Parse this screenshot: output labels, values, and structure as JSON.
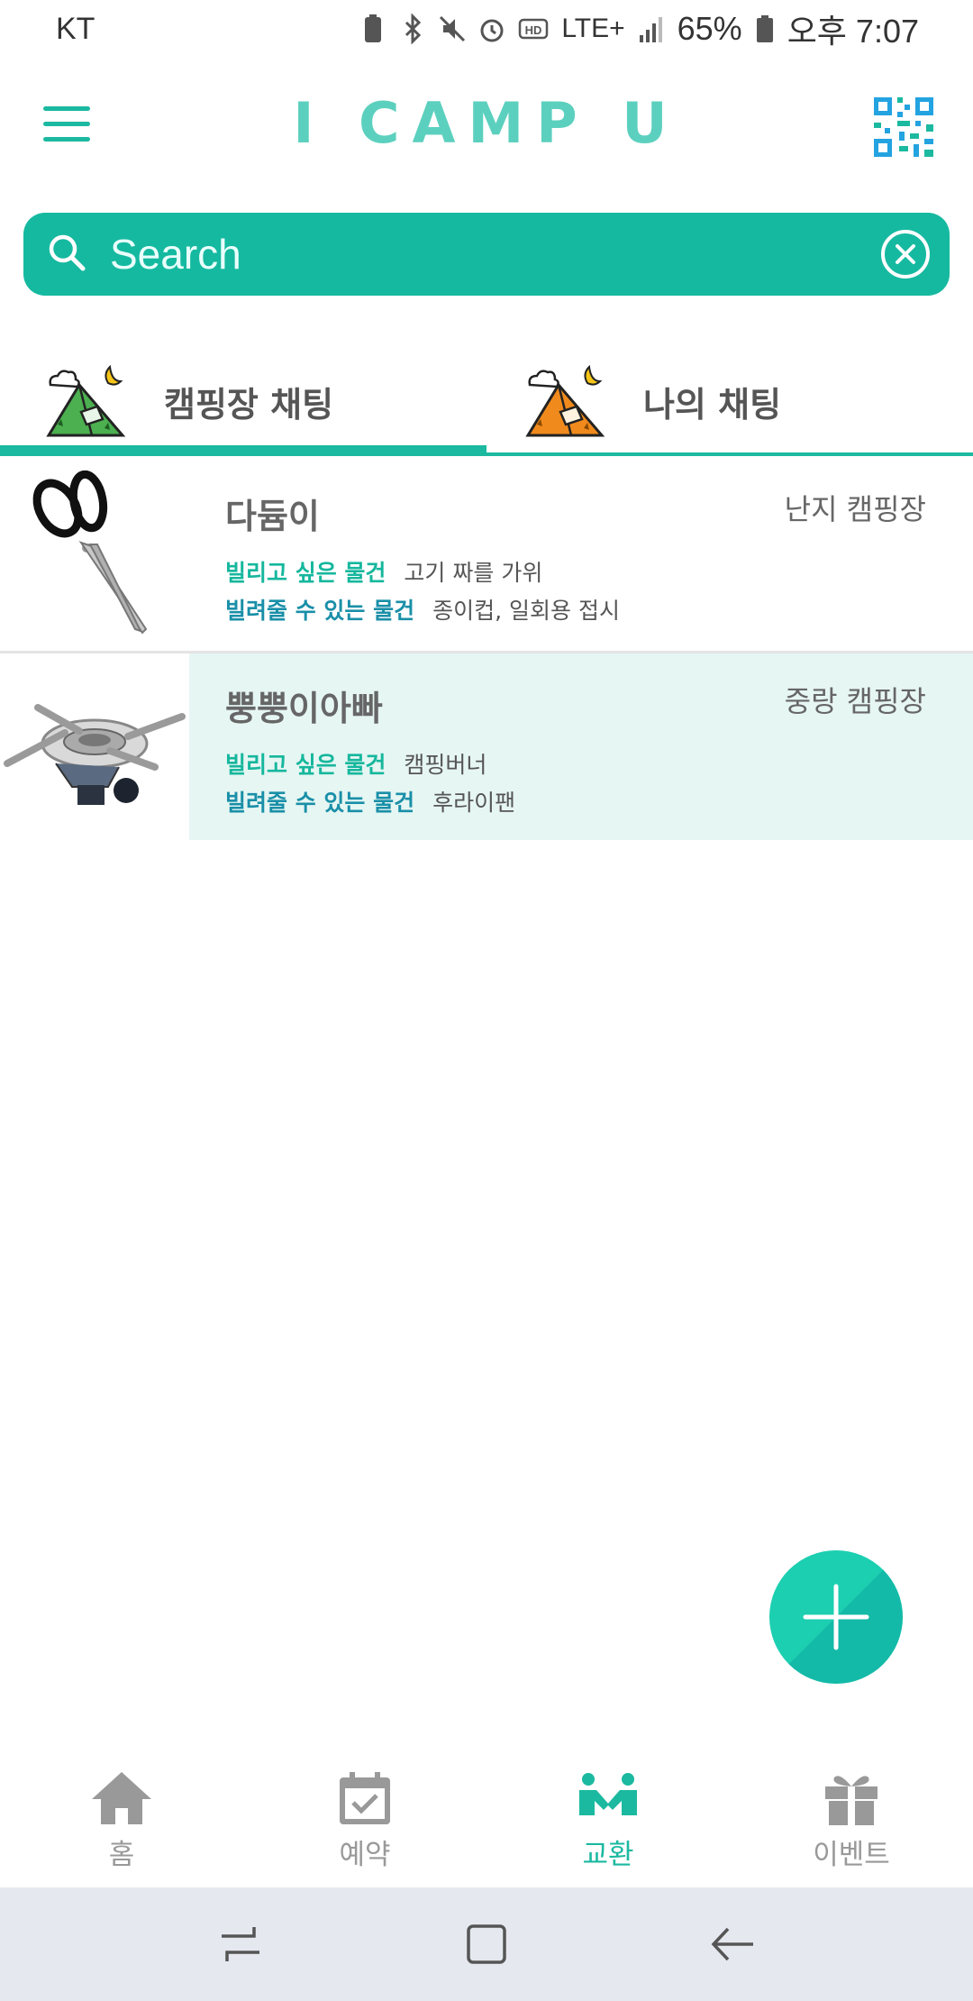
{
  "status_bar": {
    "carrier": "KT",
    "network": "LTE+",
    "battery": "65%",
    "time": "오후 7:07"
  },
  "header": {
    "title": "I CAMP U"
  },
  "search": {
    "placeholder": "Search"
  },
  "tabs": [
    {
      "label": "캠핑장 채팅",
      "tent_color": "#4caf50",
      "active": true
    },
    {
      "label": "나의 채팅",
      "tent_color": "#f08a1c",
      "active": false
    }
  ],
  "list": [
    {
      "name": "다듐이",
      "campsite": "난지 캠핑장",
      "want_label": "빌리고 싶은 물건",
      "want_value": "고기 짜를 가위",
      "lend_label": "빌려줄 수 있는 물건",
      "lend_value": "종이컵, 일회용 접시",
      "thumbnail": "scissors-image"
    },
    {
      "name": "뿡뿡이아빠",
      "campsite": "중랑 캠핑장",
      "want_label": "빌리고 싶은 물건",
      "want_value": "캠핑버너",
      "lend_label": "빌려줄 수 있는 물건",
      "lend_value": "후라이팬",
      "thumbnail": "camping-stove-image"
    }
  ],
  "bottom_nav": [
    {
      "label": "홈",
      "icon": "home-icon",
      "active": false
    },
    {
      "label": "예약",
      "icon": "calendar-check-icon",
      "active": false
    },
    {
      "label": "교환",
      "icon": "handshake-icon",
      "active": true
    },
    {
      "label": "이벤트",
      "icon": "gift-icon",
      "active": false
    }
  ],
  "colors": {
    "accent": "#1bb9a0",
    "accent_light": "#e6f6f3",
    "inactive": "#999999"
  }
}
